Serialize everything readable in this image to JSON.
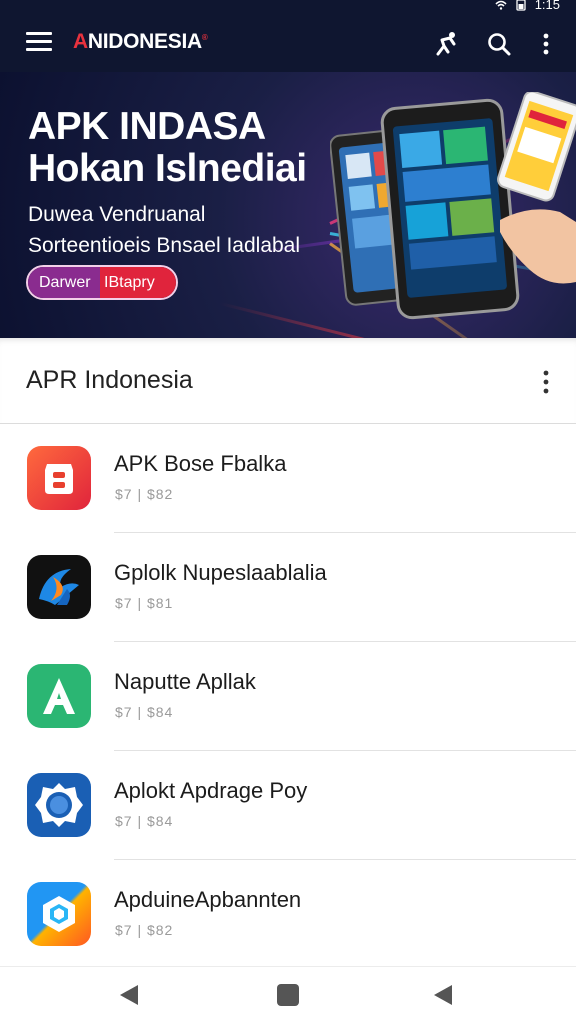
{
  "status_bar": {
    "time": "1:15"
  },
  "app_bar": {
    "logo_first": "A",
    "logo_rest": "NIDONESIA",
    "logo_mark": "®"
  },
  "hero": {
    "title_line1": "APK INDASA",
    "title_line2": "Hokan Islnediai",
    "subtitle_line1": "Duwea Vendruanal",
    "subtitle_line2": "Sorteentioeis Bnsael Iadlabal",
    "button_left": "Darwer",
    "button_right": "IBtapry"
  },
  "section": {
    "title": "APR Indonesia"
  },
  "apps": [
    {
      "name": "APK Bose Fbalka",
      "meta": "$7 | $82",
      "icon": "red-box-icon"
    },
    {
      "name": "Gplolk Nupeslaablalia",
      "meta": "$7 | $81",
      "icon": "blue-swirl-icon"
    },
    {
      "name": "Naputte Apllak",
      "meta": "$7 | $84",
      "icon": "green-a-icon"
    },
    {
      "name": "Aplokt Apdrage Poy",
      "meta": "$7 | $84",
      "icon": "blue-gear-icon"
    },
    {
      "name": "ApduineApbannten",
      "meta": "$7 | $82",
      "icon": "hexagon-icon"
    }
  ],
  "colors": {
    "appbar": "#0f1630",
    "accent_red": "#e0243c",
    "accent_purple": "#8a2c8f",
    "green": "#2bb673",
    "blue": "#1a5fb4"
  }
}
